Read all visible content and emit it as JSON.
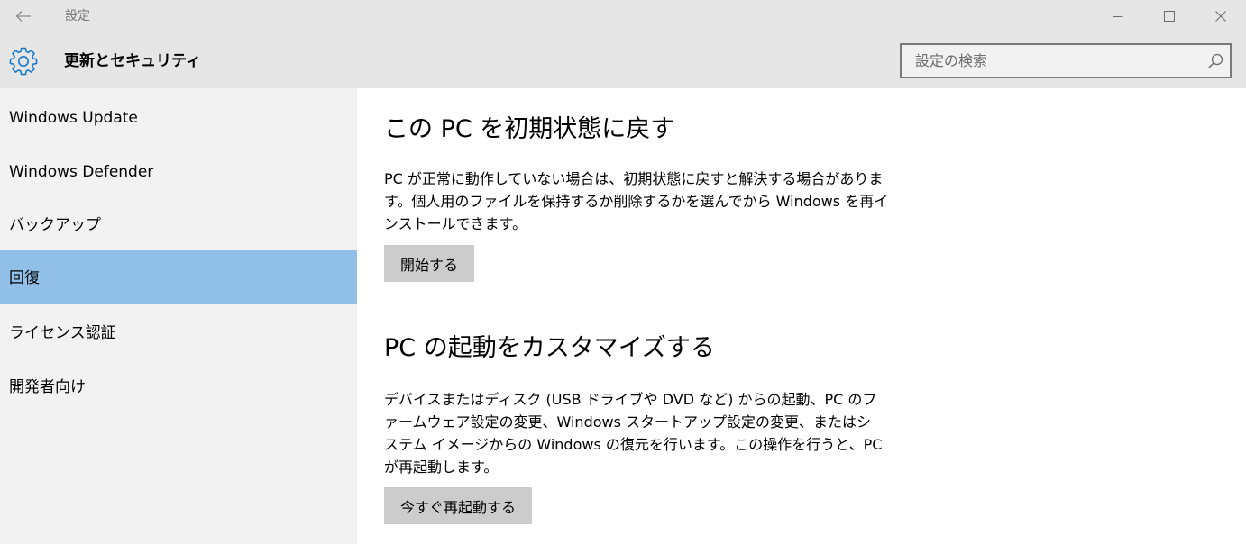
{
  "window": {
    "title": "設定",
    "back_icon": "arrow-left-icon",
    "controls": [
      "minimize-icon",
      "maximize-icon",
      "close-icon"
    ]
  },
  "header": {
    "icon": "gear-icon",
    "title": "更新とセキュリティ",
    "search": {
      "placeholder": "設定の検索",
      "value": "",
      "icon": "search-icon"
    }
  },
  "sidebar": {
    "items": [
      {
        "label": "Windows Update"
      },
      {
        "label": "Windows Defender"
      },
      {
        "label": "バックアップ"
      },
      {
        "label": "回復",
        "selected": true
      },
      {
        "label": "ライセンス認証"
      },
      {
        "label": "開発者向け"
      }
    ]
  },
  "main": {
    "sections": [
      {
        "title": "この PC を初期状態に戻す",
        "description": "PC が正常に動作していない場合は、初期状態に戻すと解決する場合があります。個人用のファイルを保持するか削除するかを選んでから Windows を再インストールできます。",
        "button": "開始する"
      },
      {
        "title": "PC の起動をカスタマイズする",
        "description": "デバイスまたはディスク (USB ドライブや DVD など) からの起動、PC のファームウェア設定の変更、Windows スタートアップ設定の変更、またはシステム イメージからの Windows の復元を行います。この操作を行うと、PC が再起動します。",
        "button": "今すぐ再起動する"
      }
    ]
  },
  "colors": {
    "chrome": "#e6e6e6",
    "sidebar": "#f2f2f2",
    "selected": "#90c0e8",
    "accent": "#1979ca",
    "button": "#cccccc"
  }
}
